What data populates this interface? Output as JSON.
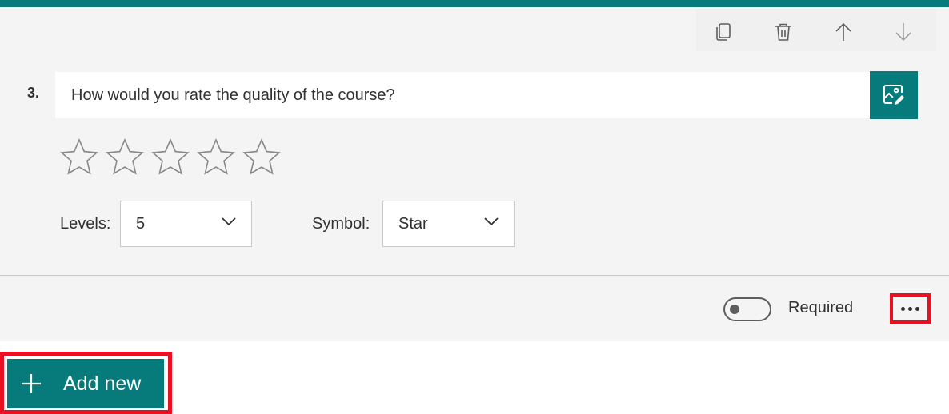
{
  "question": {
    "number": "3.",
    "title": "How would you rate the quality of the course?",
    "rating": {
      "levels": 5,
      "symbol": "star",
      "selected": 0
    }
  },
  "toolbar": {
    "copy_icon": "copy-icon",
    "delete_icon": "trash-icon",
    "move_up_icon": "arrow-up-icon",
    "move_down_icon": "arrow-down-icon"
  },
  "settings": {
    "levels_label": "Levels:",
    "levels_value": "5",
    "symbol_label": "Symbol:",
    "symbol_value": "Star"
  },
  "footer": {
    "required_label": "Required",
    "required_on": false,
    "more_icon": "more-options-icon"
  },
  "add_new": {
    "label": "Add new",
    "icon": "plus-icon"
  },
  "colors": {
    "accent": "#077a7c",
    "highlight": "#e81123",
    "card_bg": "#f4f4f4"
  }
}
